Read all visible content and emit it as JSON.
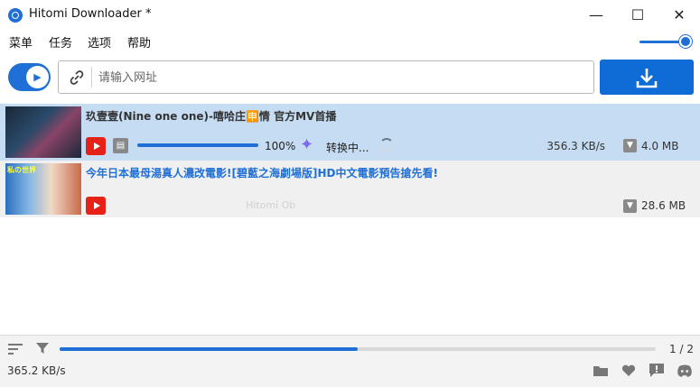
{
  "window": {
    "title": "Hitomi Downloader *",
    "minimize_glyph": "—",
    "maximize_glyph": "☐",
    "close_glyph": "✕"
  },
  "menu": {
    "items": [
      "菜单",
      "任务",
      "选项",
      "帮助"
    ]
  },
  "toolbar": {
    "url_placeholder": "请输入网址",
    "url_value": "",
    "volume_level": 1.0
  },
  "downloads": [
    {
      "title": "玖壹壹(Nine one one)-嘻哈庄🈸情 官方MV首播",
      "source": "youtube",
      "progress": 1.0,
      "progress_label": "100%",
      "status": "转换中...",
      "speed": "356.3 KB/s",
      "size": "4.0 MB",
      "selected": true
    },
    {
      "title": "今年日本最母湯真人濃改電影![碧藍之海劇場版]HD中文電影預告搶先看!",
      "source": "youtube",
      "size": "28.6 MB",
      "thumbnail_caption": "私の世界",
      "watermark": "Hitomi Ob",
      "selected": false
    }
  ],
  "status_bar": {
    "total_progress": 0.5,
    "page_count": "1 / 2",
    "speed": "365.2 KB/s"
  },
  "icons": {
    "accent": "#1f6fd6",
    "youtube": "#e62117"
  }
}
